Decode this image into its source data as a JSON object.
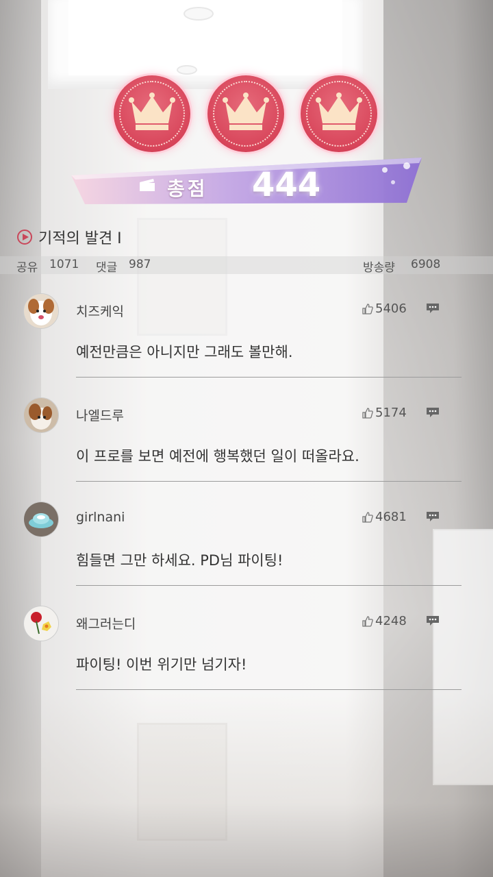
{
  "score": {
    "label": "총점",
    "value": "444",
    "crowns": 3
  },
  "video": {
    "title": "기적의 발견 I"
  },
  "stats": {
    "share_label": "공유",
    "share_value": "1071",
    "comment_label": "댓글",
    "comment_value": "987",
    "views_label": "방송량",
    "views_value": "6908"
  },
  "comments": [
    {
      "name": "치즈케익",
      "likes": "5406",
      "text": "예전만큼은 아니지만 그래도 볼만해."
    },
    {
      "name": "나엘드루",
      "likes": "5174",
      "text": "이 프로를 보면 예전에 행복했던 일이 떠올라요."
    },
    {
      "name": "girlnani",
      "likes": "4681",
      "text": "힘들면 그만 하세요. PD님 파이팅!"
    },
    {
      "name": "왜그러는디",
      "likes": "4248",
      "text": "파이팅! 이번 위기만 넘기자!"
    }
  ],
  "colors": {
    "crown": "#d8455a",
    "banner_start": "#f3c9d9",
    "banner_end": "#8a6fd2"
  }
}
